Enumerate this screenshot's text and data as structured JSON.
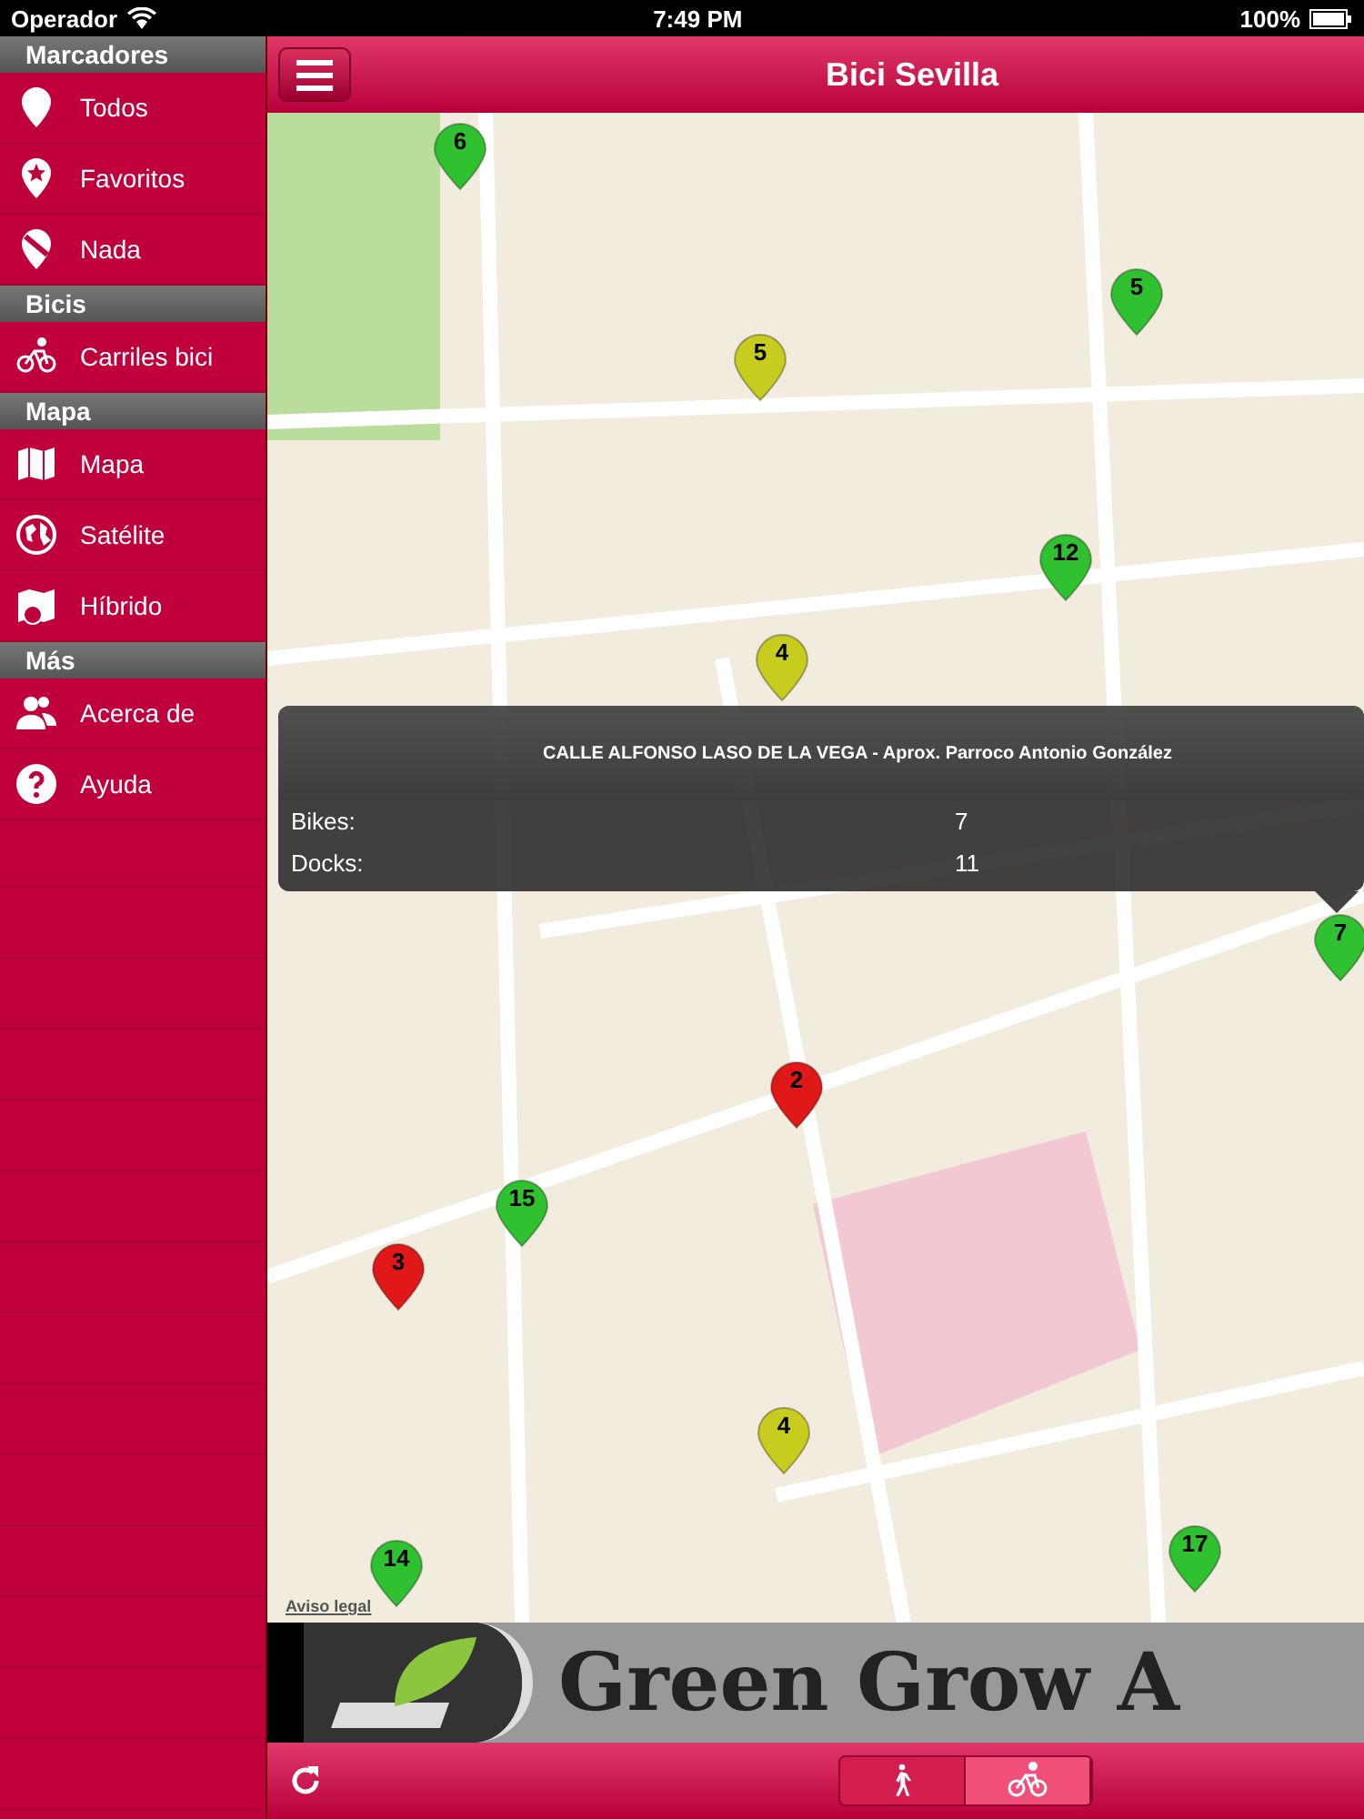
{
  "status_bar": {
    "carrier": "Operador",
    "time": "7:49 PM",
    "battery": "100%"
  },
  "sidebar": {
    "sections": [
      {
        "title": "Marcadores",
        "items": [
          {
            "label": "Todos",
            "kind": "pin"
          },
          {
            "label": "Favoritos",
            "kind": "star-pin"
          },
          {
            "label": "Nada",
            "kind": "no-pin"
          }
        ]
      },
      {
        "title": "Bicis",
        "items": [
          {
            "label": "Carriles bici",
            "kind": "bike"
          }
        ]
      },
      {
        "title": "Mapa",
        "items": [
          {
            "label": "Mapa",
            "kind": "map"
          },
          {
            "label": "Satélite",
            "kind": "globe"
          },
          {
            "label": "Híbrido",
            "kind": "hybrid"
          }
        ]
      },
      {
        "title": "Más",
        "items": [
          {
            "label": "Acerca de",
            "kind": "people"
          },
          {
            "label": "Ayuda",
            "kind": "help"
          }
        ]
      }
    ]
  },
  "nav_bar": {
    "title": "Bici Sevilla"
  },
  "map": {
    "pins": [
      {
        "count": "6",
        "color": "#2fc12f"
      },
      {
        "count": "5",
        "color": "#c8cc1e"
      },
      {
        "count": "5",
        "color": "#2fc12f"
      },
      {
        "count": "12",
        "color": "#2fc12f"
      },
      {
        "count": "4",
        "color": "#c8cc1e"
      },
      {
        "count": "7",
        "color": "#2fc12f"
      },
      {
        "count": "2",
        "color": "#e01818"
      },
      {
        "count": "15",
        "color": "#2fc12f"
      },
      {
        "count": "3",
        "color": "#e01818"
      },
      {
        "count": "4",
        "color": "#c8cc1e"
      },
      {
        "count": "17",
        "color": "#2fc12f"
      },
      {
        "count": "14",
        "color": "#2fc12f"
      }
    ],
    "callout": {
      "title": "CALLE ALFONSO LASO DE LA VEGA - Aprox. Parroco Antonio González",
      "rows": [
        {
          "label": "Bikes:",
          "value": "7"
        },
        {
          "label": "Docks:",
          "value": "11"
        }
      ]
    },
    "legal_link": "Aviso legal"
  },
  "banner": {
    "text": "Green Grow A"
  },
  "bottom_bar": {
    "modes": [
      {
        "kind": "walk",
        "selected": false
      },
      {
        "kind": "bike",
        "selected": true
      }
    ]
  }
}
